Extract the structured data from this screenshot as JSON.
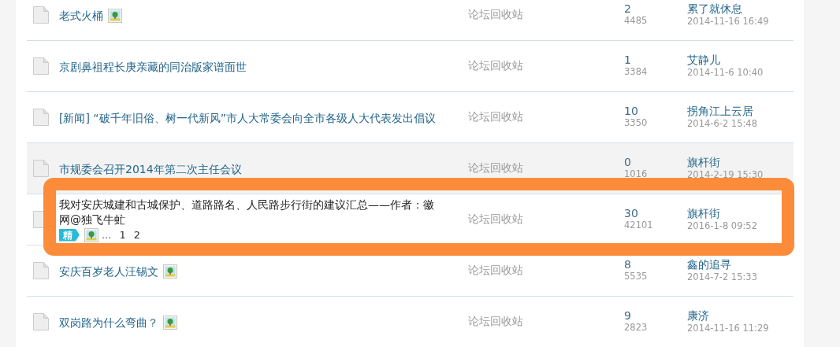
{
  "threads": [
    {
      "title": "老式火桶",
      "attachment": true,
      "forum": "论坛回收站",
      "replies": "2",
      "views": "4485",
      "last_poster": "累了就休息",
      "last_time": "2014-11-16 16:49",
      "hovered": false,
      "highlighted": false,
      "visited": false
    },
    {
      "title": "京剧鼻祖程长庚亲藏的同治版家谱面世",
      "attachment": false,
      "forum": "论坛回收站",
      "replies": "1",
      "views": "3384",
      "last_poster": "艾静儿",
      "last_time": "2014-11-6 10:40",
      "hovered": false,
      "highlighted": false,
      "visited": false
    },
    {
      "title": "[新闻] “破千年旧俗、树一代新风”市人大常委会向全市各级人大代表发出倡议",
      "attachment": false,
      "forum": "论坛回收站",
      "replies": "10",
      "views": "3350",
      "last_poster": "拐角江上云居",
      "last_time": "2014-6-2 15:48",
      "hovered": false,
      "highlighted": false,
      "visited": false
    },
    {
      "title": "市规委会召开2014年第二次主任会议",
      "attachment": false,
      "forum": "论坛回收站",
      "replies": "0",
      "views": "1016",
      "last_poster": "旗杆街",
      "last_time": "2014-2-19 15:30",
      "hovered": true,
      "highlighted": false,
      "visited": false
    },
    {
      "title": "我对安庆城建和古城保护、道路路名、人民路步行街的建议汇总——作者：徽网@独飞牛虻",
      "digest": "精",
      "attachment": true,
      "pages": {
        "ellipsis": "...",
        "numbers": [
          "1",
          "2"
        ]
      },
      "forum": "论坛回收站",
      "replies": "30",
      "views": "42101",
      "last_poster": "旗杆街",
      "last_time": "2016-1-8 09:52",
      "hovered": false,
      "highlighted": true,
      "visited": true
    },
    {
      "title": "安庆百岁老人汪锡文",
      "attachment": true,
      "forum": "论坛回收站",
      "replies": "8",
      "views": "5535",
      "last_poster": "鑫的追寻",
      "last_time": "2014-7-2 15:33",
      "hovered": false,
      "highlighted": false,
      "visited": false
    },
    {
      "title": "双岗路为什么弯曲？",
      "attachment": true,
      "forum": "论坛回收站",
      "replies": "9",
      "views": "2823",
      "last_poster": "康济",
      "last_time": "2014-11-16 11:29",
      "hovered": false,
      "highlighted": false,
      "visited": false
    }
  ]
}
